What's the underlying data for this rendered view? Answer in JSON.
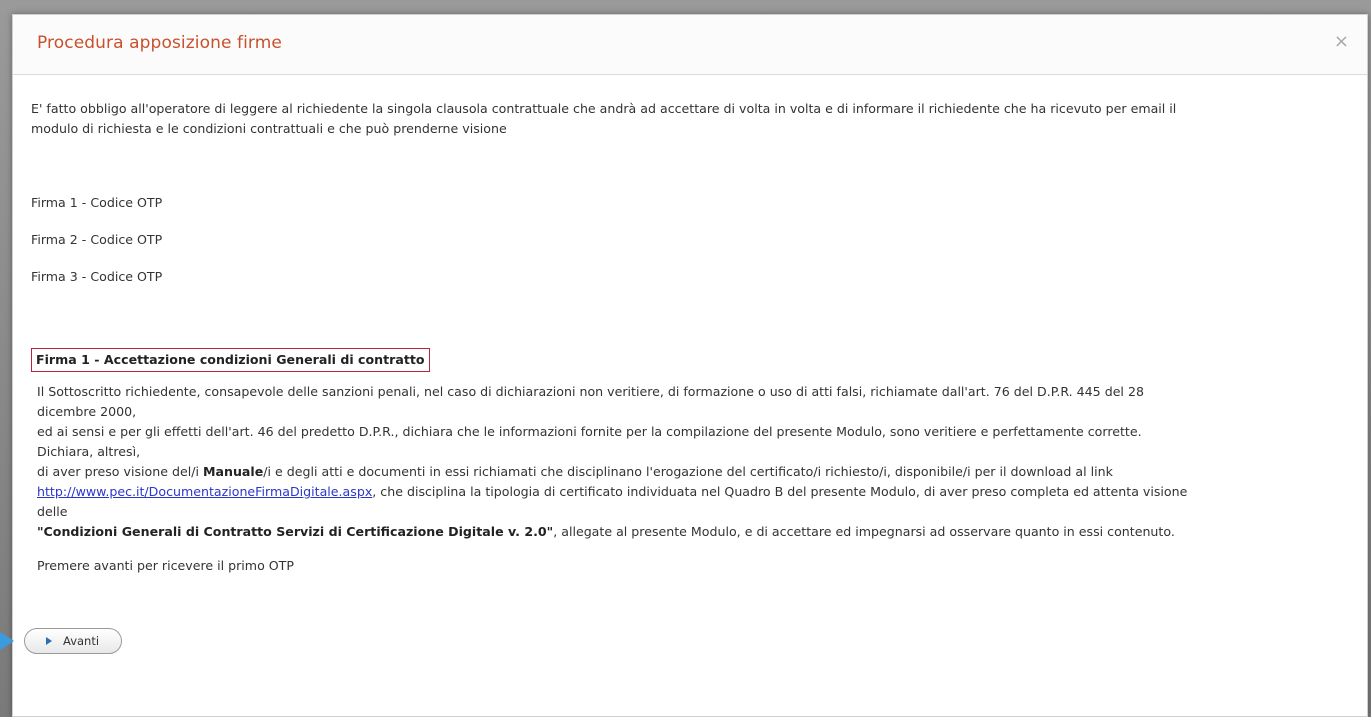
{
  "dialog": {
    "title": "Procedura apposizione firme",
    "close_glyph": "×",
    "close_icon": "close-icon"
  },
  "intro": {
    "line1": "E' fatto obbligo all'operatore di leggere al richiedente la singola clausola contrattuale che andrà ad accettare di volta in volta e di informare il richiedente che ha ricevuto per email il",
    "line2": "modulo di richiesta e le condizioni contrattuali e che può prenderne visione"
  },
  "otp_items": [
    "Firma 1 - Codice OTP",
    "Firma 2 - Codice OTP",
    "Firma 3 - Codice OTP"
  ],
  "section": {
    "heading": "Firma 1 - Accettazione condizioni Generali di contratto",
    "clause": {
      "p1a": "Il Sottoscritto richiedente, consapevole delle sanzioni penali, nel caso di dichiarazioni non veritiere, di formazione o uso di atti falsi, richiamate dall'art. 76 del D.P.R. 445 del 28",
      "p1b": "dicembre 2000,",
      "p2": "ed ai sensi e per gli effetti dell'art. 46 del predetto D.P.R., dichiara che le informazioni fornite per la compilazione del presente Modulo, sono veritiere e perfettamente corrette.",
      "p3": "Dichiara, altresì,",
      "p4_pre": "di aver preso visione del/i ",
      "p4_bold": "Manuale",
      "p4_post": "/i e degli atti e documenti in essi richiamati che disciplinano l'erogazione del certificato/i richiesto/i, disponibile/i per il download al link",
      "link": "http://www.pec.it/DocumentazioneFirmaDigitale.aspx",
      "p5_post": ", che disciplina la tipologia di certificato individuata nel Quadro B del presente Modulo, di aver preso completa ed attenta visione",
      "p6": "delle",
      "p7_bold": "\"Condizioni Generali di Contratto Servizi di Certificazione Digitale v. 2.0\"",
      "p7_post": ", allegate al presente Modulo, e di accettare ed impegnarsi ad osservare quanto in essi contenuto."
    },
    "premere": "Premere avanti per ricevere il primo OTP"
  },
  "button": {
    "label": "Avanti",
    "icon": "play-arrow-icon"
  },
  "colors": {
    "title": "#c9502c",
    "heading_border": "#b8233f",
    "link": "#2a36c9",
    "button_arrow": "#2a6fb3",
    "pointer": "#3b9be0"
  }
}
